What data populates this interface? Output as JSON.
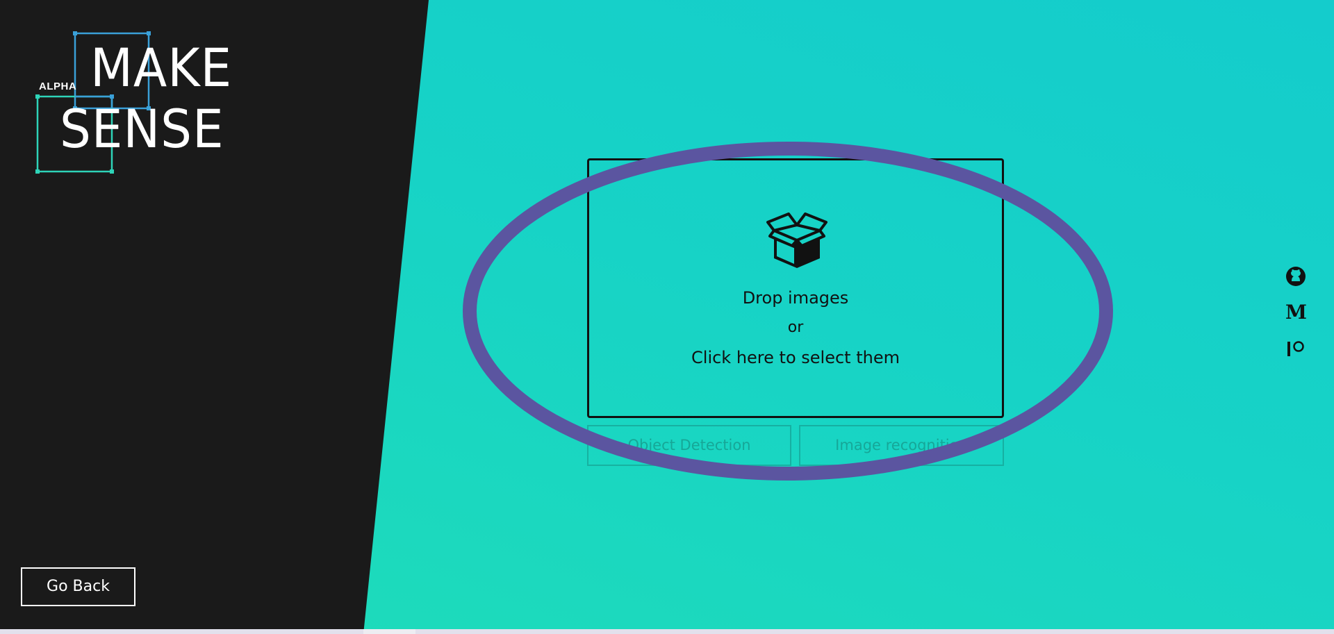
{
  "logo": {
    "badge": "ALPHA",
    "line1": "MAKE",
    "line2": "SENSE"
  },
  "nav": {
    "go_back_label": "Go Back"
  },
  "dropzone": {
    "icon": "box-open-icon",
    "title": "Drop images",
    "or_text": "or",
    "click_text": "Click here to select them"
  },
  "modes": {
    "object_detection_label": "Object Detection",
    "image_recognition_label": "Image recognition"
  },
  "social": {
    "github_icon": "github-icon",
    "medium_label": "M",
    "patreon_icon": "patreon-icon"
  },
  "colors": {
    "panel_dark": "#1a1a1a",
    "gradient_top": "#14cccc",
    "gradient_bottom": "#1fddb8",
    "annotation_ellipse": "#5b55a0",
    "logo_blue": "#3aa0d8",
    "logo_teal": "#2ed4b8"
  }
}
